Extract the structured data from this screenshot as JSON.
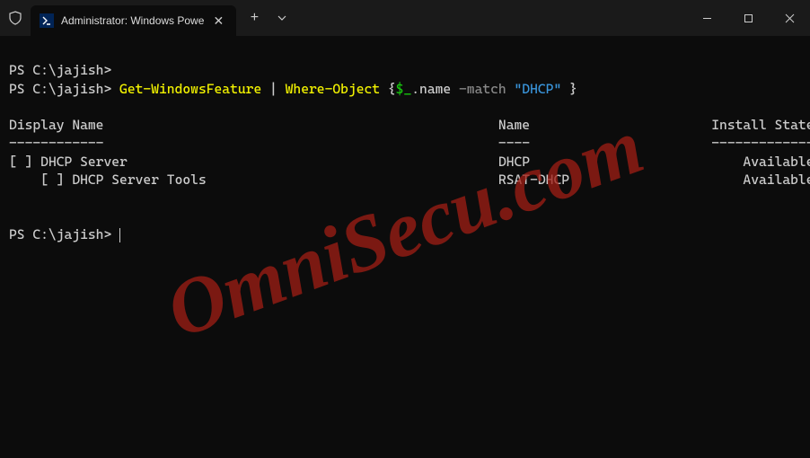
{
  "titlebar": {
    "tab_title": "Administrator: Windows Powe"
  },
  "terminal": {
    "prompt1": "PS C:\\jajish>",
    "prompt2": "PS C:\\jajish> ",
    "cmd_part1": "Get-WindowsFeature",
    "cmd_pipe": " | ",
    "cmd_part2": "Where-Object",
    "cmd_brace_open": " {",
    "cmd_var": "$_",
    "cmd_member": ".name ",
    "cmd_op": "-match ",
    "cmd_string": "\"DHCP\"",
    "cmd_brace_close": " }",
    "header_display": "Display Name",
    "header_name": "Name",
    "header_install": "Install State",
    "sep_display": "------------",
    "sep_name": "----",
    "sep_install": "-------------",
    "row1_display": "[ ] DHCP Server",
    "row1_name": "DHCP",
    "row1_install": "Available",
    "row2_display": "    [ ] DHCP Server Tools",
    "row2_name": "RSAT-DHCP",
    "row2_install": "Available",
    "prompt3": "PS C:\\jajish> "
  },
  "watermark": "OmniSecu.com"
}
